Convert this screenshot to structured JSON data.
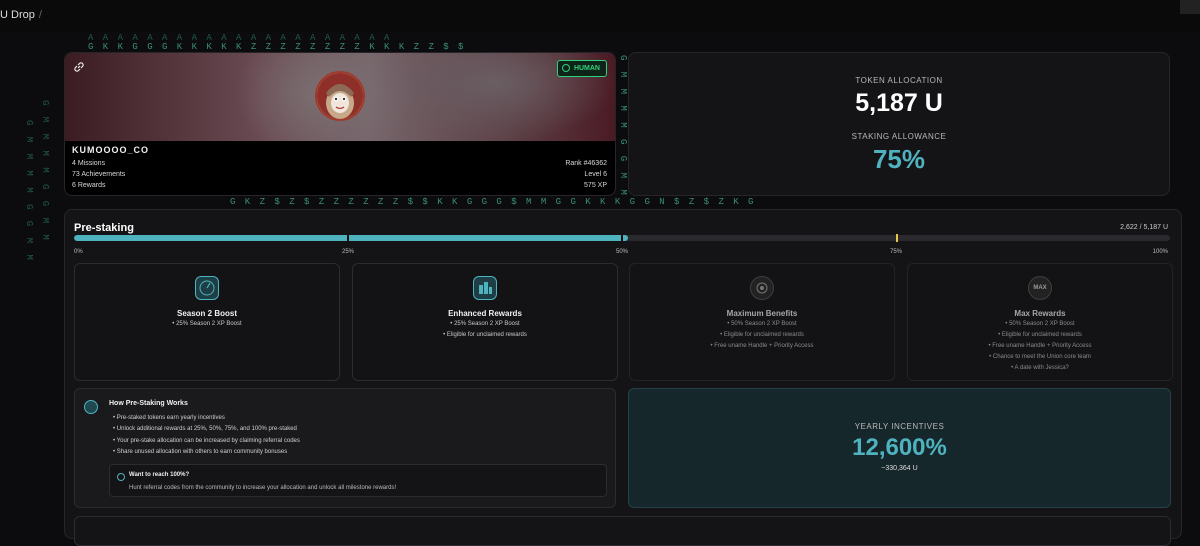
{
  "breadcrumb": {
    "title": "U Drop",
    "separator": "/"
  },
  "matrix": {
    "row1": "A A A A A A A A A A A A A A A A A A A A A",
    "row2": "G K K     G G G K K K K K Z Z Z Z Z Z Z Z K K K Z Z $ $",
    "row3": "G K Z $ Z $ Z Z Z Z Z Z $ $ K K G G G $ M M G G K K K G G N   $ Z $ Z K G",
    "col": "G M M M M G G M M"
  },
  "profile": {
    "username": "KUMOOOO_CO",
    "badge": "HUMAN",
    "stats_left": [
      "4 Missions",
      "73 Achievements",
      "6 Rewards"
    ],
    "stats_right": [
      "Rank #46362",
      "Level 6",
      "575 XP"
    ]
  },
  "token": {
    "allocation_label": "TOKEN ALLOCATION",
    "allocation_value": "5,187 U",
    "staking_label": "STAKING ALLOWANCE",
    "staking_value": "75%"
  },
  "prestaking": {
    "title": "Pre-staking",
    "count": "2,622 / 5,187 U",
    "progress_fraction": 0.5055,
    "ticks": [
      "0%",
      "25%",
      "50%",
      "75%",
      "100%"
    ]
  },
  "tiers": [
    {
      "title": "Season 2 Boost",
      "icon": "boost-icon",
      "items": [
        "25% Season 2 XP Boost"
      ]
    },
    {
      "title": "Enhanced Rewards",
      "icon": "rewards-icon",
      "items": [
        "25% Season 2 XP Boost",
        "Eligible for unclaimed rewards"
      ]
    },
    {
      "title": "Maximum Benefits",
      "icon": "benefits-icon",
      "items": [
        "50% Season 2 XP Boost",
        "Eligible for unclaimed rewards",
        "Free uname Handle + Priority Access"
      ]
    },
    {
      "title": "Max Rewards",
      "icon": "max-icon",
      "icon_text": "MAX",
      "items": [
        "50% Season 2 XP Boost",
        "Eligible for unclaimed rewards",
        "Free uname Handle + Priority Access",
        "Chance to meet the Union core team",
        "A date with Jessica?"
      ]
    }
  ],
  "how": {
    "title": "How Pre-Staking Works",
    "items": [
      "Pre-staked tokens earn yearly incentives",
      "Unlock additional rewards at 25%, 50%, 75%, and 100% pre-staked",
      "Your pre-stake allocation can be increased by claiming referral codes",
      "Share unused allocation with others to earn community bonuses"
    ],
    "reach_title": "Want to reach 100%?",
    "reach_text": "Hunt referral codes from the community to increase your allocation and unlock all milestone rewards!"
  },
  "yearly": {
    "label": "YEARLY INCENTIVES",
    "value": "12,600%",
    "sub": "~330,364 U"
  },
  "colors": {
    "accent": "#4fb3bf",
    "human": "#2fd07a",
    "marker75": "#e8c24a"
  }
}
